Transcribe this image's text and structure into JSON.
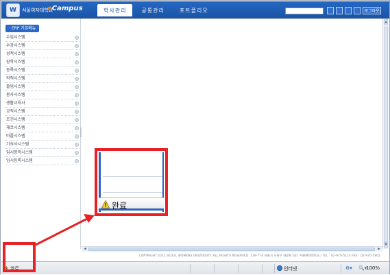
{
  "header": {
    "logo_text": "W",
    "university_name": "서울여자대학교",
    "campus_logo_e": "e",
    "campus_logo_text": "Campus",
    "tabs": [
      {
        "label": "학사관리",
        "active": true
      },
      {
        "label": "공통관리",
        "active": false
      },
      {
        "label": "포트폴리오",
        "active": false
      }
    ],
    "search_placeholder": "",
    "logout_label": "로그아웃"
  },
  "sidebar": {
    "title": "· ERP 기본메뉴",
    "items": [
      {
        "label": "수업시스템"
      },
      {
        "label": "수강시스템"
      },
      {
        "label": "성적시스템"
      },
      {
        "label": "장학시스템"
      },
      {
        "label": "등록시스템"
      },
      {
        "label": "학적시스템"
      },
      {
        "label": "졸업시스템"
      },
      {
        "label": "봉사시스템"
      },
      {
        "label": "생활교육사"
      },
      {
        "label": "교직시스템"
      },
      {
        "label": "조건시스템"
      },
      {
        "label": "채코시스템"
      },
      {
        "label": "비플시스템"
      },
      {
        "label": "기숙사시스템"
      },
      {
        "label": "입시장학시스템"
      },
      {
        "label": "입시등록시스템"
      }
    ]
  },
  "footer": {
    "copyright": "COPYRIGHT 2011 SEOUL WOMENS UNIVERSITY. ALL RIGHTS RESERVED. 139-774 서울시 노원구 화랑로 621 서울여자대학교 / TEL : 02-970-5114 FAX : 02-970-5901"
  },
  "statusbar": {
    "status": "완료",
    "zone": "인터넷",
    "zoom": "100%"
  },
  "callout": {
    "status": "완료"
  },
  "colors": {
    "brand_blue": "#1b55a6",
    "highlight_red": "#e52226"
  },
  "icons": {
    "warning": "warning-icon",
    "globe": "internet-zone-icon",
    "zoom": "zoom-icon"
  }
}
